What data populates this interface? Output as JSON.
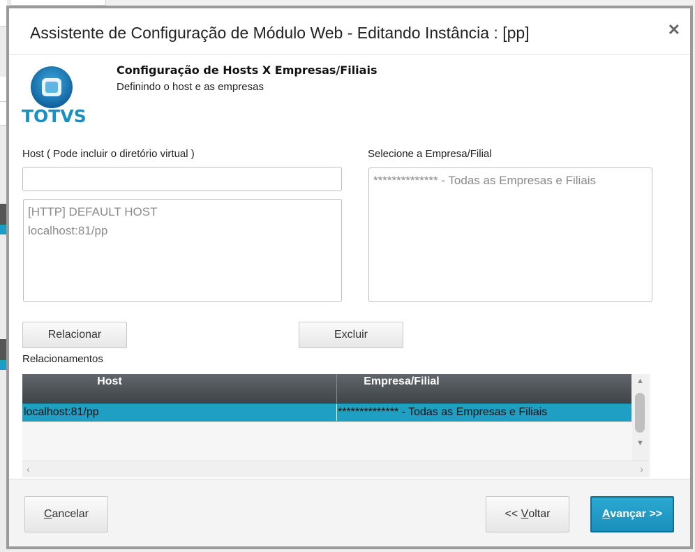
{
  "dialog": {
    "title": "Assistente de Configuração de Módulo Web - Editando Instância : [pp]",
    "close_icon": "close-icon"
  },
  "logo": {
    "text": "TOTVS",
    "color": "#1a8fc4"
  },
  "step": {
    "title": "Configuração de Hosts X Empresas/Filiais",
    "subtitle": "Definindo o host e as empresas"
  },
  "host": {
    "label": "Host ( Pode incluir o diretório virtual )",
    "input_value": "",
    "list": [
      "[HTTP] DEFAULT HOST",
      "localhost:81/pp"
    ]
  },
  "empresa": {
    "label": "Selecione a Empresa/Filial",
    "list": [
      "************** - Todas as Empresas e Filiais"
    ]
  },
  "buttons": {
    "relacionar": "Relacionar",
    "excluir": "Excluir"
  },
  "relacionamentos": {
    "label": "Relacionamentos",
    "columns": [
      "Host",
      "Empresa/Filial"
    ],
    "rows": [
      {
        "host": "localhost:81/pp",
        "empresa": "************** - Todas as Empresas e Filiais"
      }
    ],
    "selected_row_color": "#1e9fc3"
  },
  "footer": {
    "cancelar_first": "C",
    "cancelar_rest": "ancelar",
    "voltar_prefix": "<< ",
    "voltar_u": "V",
    "voltar_rest": "oltar",
    "avancar_u": "A",
    "avancar_rest": "vançar >>"
  }
}
